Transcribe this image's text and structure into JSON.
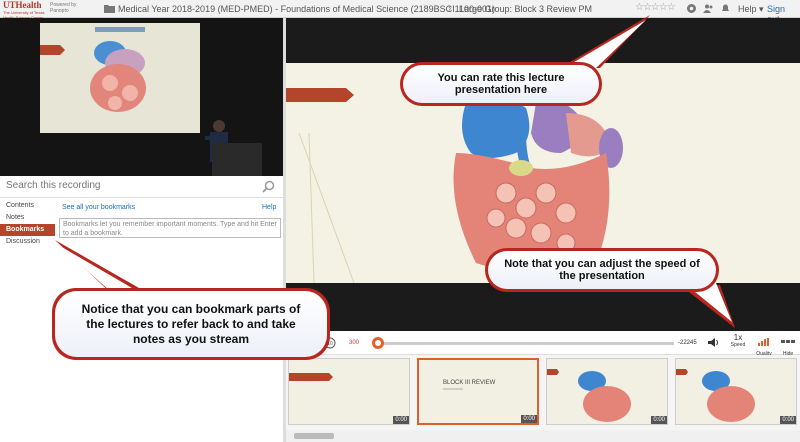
{
  "header": {
    "logo_main": "UTHealth",
    "logo_sub": "The University of Texas Health Science Center at Houston",
    "powered_by": "Powered by Panopto",
    "breadcrumb_folder": "Medical Year 2018-2019 (MED-PMED) - Foundations of Medical Science (2189BSCI1100-001)",
    "breadcrumb_session": "Large Group: Block 3 Review PM",
    "rating_stars": "☆☆☆☆☆",
    "help": "Help",
    "sign_out": "Sign out"
  },
  "sidebar": {
    "search_placeholder": "Search this recording",
    "tabs": [
      "Contents",
      "Notes",
      "Bookmarks",
      "Discussion"
    ],
    "active_tab": "Bookmarks",
    "see_all": "See all your bookmarks",
    "help": "Help",
    "bookmark_placeholder": "Bookmarks let you remember important moments. Type and hit Enter to add a bookmark."
  },
  "player": {
    "speed": "1x",
    "speed_label": "Speed",
    "quality_label": "Quality",
    "hide_label": "Hide",
    "elapsed": "300",
    "remaining": "-22245",
    "progress_fraction": 0.013
  },
  "thumbnails": [
    {
      "title": "",
      "time": "0:00"
    },
    {
      "title": "",
      "time": "0:00"
    },
    {
      "title": "",
      "time": "0:00"
    },
    {
      "title": "",
      "time": "0:00"
    }
  ],
  "thumbnail_slide_title": "BLOCK III REVIEW",
  "callouts": {
    "rate": "You can rate this lecture presentation here",
    "speed": "Note that you can adjust the speed of the presentation",
    "bookmark": "Notice that you can bookmark parts of the lectures to refer back to and take notes as you stream"
  },
  "colors": {
    "accent": "#b5452a",
    "callout_border": "#b8271f",
    "link": "#1a6fb5"
  }
}
